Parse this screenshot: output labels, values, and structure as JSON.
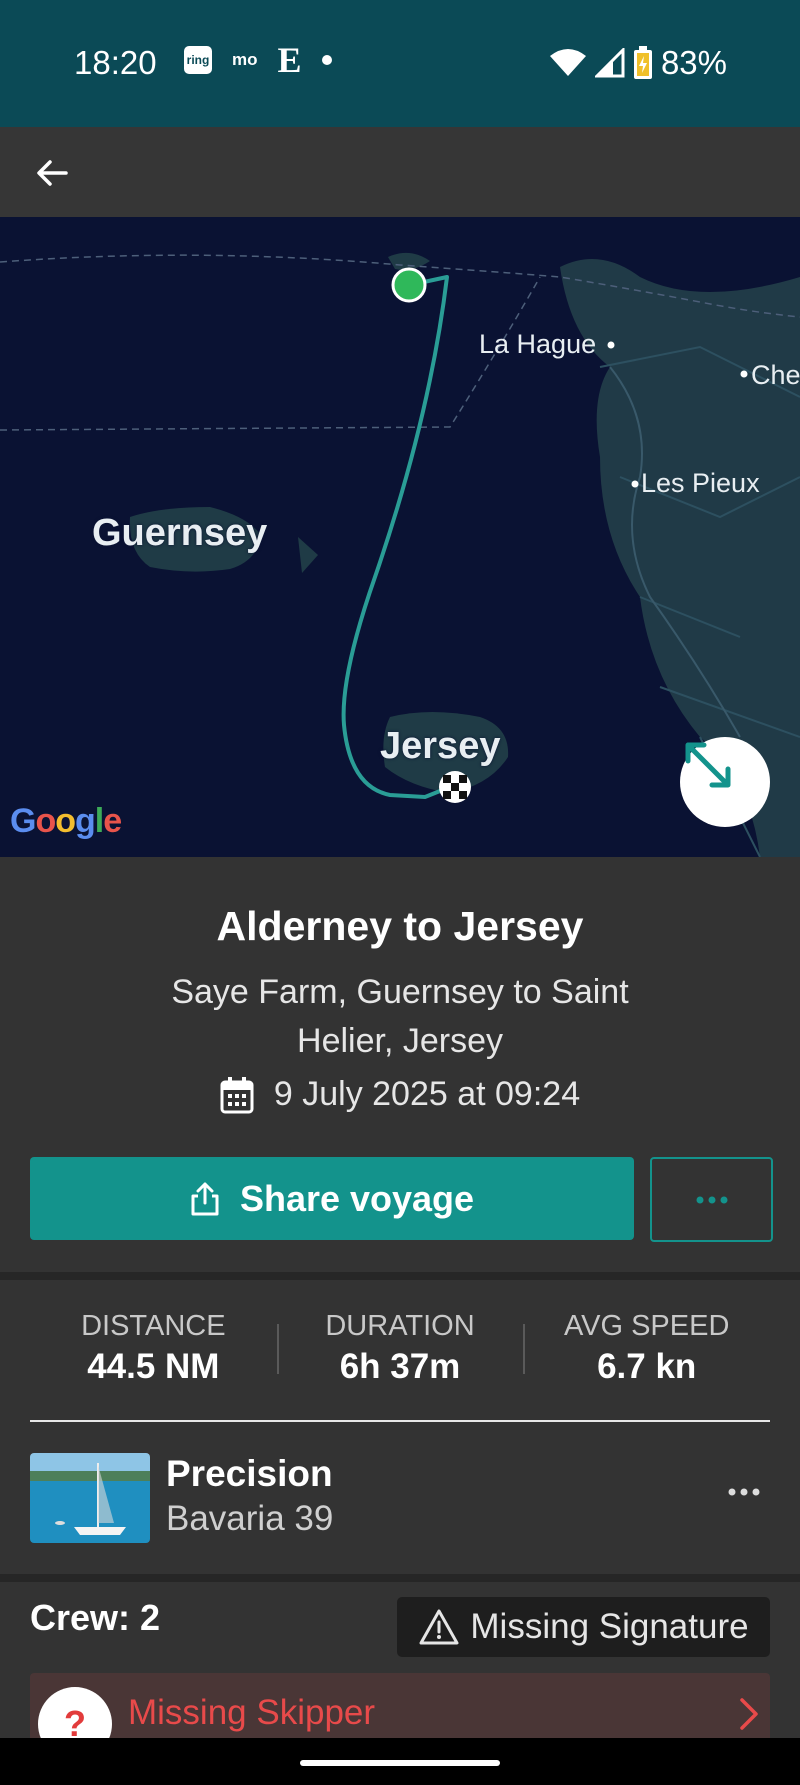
{
  "status_bar": {
    "time": "18:20",
    "ring_label": "ring",
    "mo_label": "mo",
    "e_label": "E",
    "battery": "83%"
  },
  "icons": {
    "back": "arrow-left-icon",
    "expand": "expand-diagonal-icon",
    "calendar": "calendar-icon",
    "share": "share-icon",
    "more": "more-horizontal-icon",
    "warning": "warning-triangle-icon",
    "chevron": "chevron-right-icon"
  },
  "map": {
    "labels": {
      "la_hague": "La Hague",
      "cherbourg": "Che",
      "les_pieux": "Les Pieux",
      "guernsey": "Guernsey",
      "jersey": "Jersey"
    },
    "attribution": "Google",
    "route_color": "#2a9d96",
    "start_color": "#2fb85a"
  },
  "voyage": {
    "title": "Alderney to Jersey",
    "subtitle": "Saye Farm, Guernsey to Saint Helier, Jersey",
    "date": "9 July 2025 at 09:24",
    "share_label": "Share voyage",
    "more_label": "···"
  },
  "stats": [
    {
      "label": "DISTANCE",
      "value": "44.5 NM"
    },
    {
      "label": "DURATION",
      "value": "6h 37m"
    },
    {
      "label": "AVG SPEED",
      "value": "6.7 kn"
    }
  ],
  "boat": {
    "name": "Precision",
    "model": "Bavaria 39"
  },
  "crew": {
    "label": "Crew: 2",
    "missing_signature": "Missing Signature",
    "missing_skipper": "Missing Skipper",
    "avatar_symbol": "?"
  },
  "colors": {
    "accent": "#13938c",
    "status_bar": "#0b4a56",
    "background": "#333333",
    "error": "#e84a4a"
  }
}
